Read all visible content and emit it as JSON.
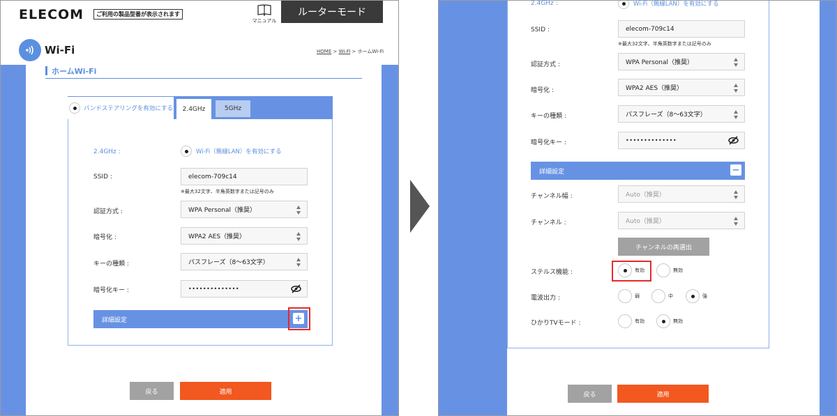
{
  "header": {
    "logo": "ELECOM",
    "tagline": "ご利用の製品型番が表示されます",
    "manual_label": "マニュアル",
    "mode_label": "ルーターモード"
  },
  "page": {
    "title": "Wi-Fi",
    "breadcrumb_home": "HOME",
    "breadcrumb_sep1": " > ",
    "breadcrumb_wifi": "Wi-Fi",
    "breadcrumb_sep2": " > ",
    "breadcrumb_current": "ホームWi-Fi",
    "section_title": "ホームWi-Fi"
  },
  "tabs": {
    "band_steering_label": "バンドステアリングを有効にする",
    "tab_24": "2.4GHz",
    "tab_5": "5GHz"
  },
  "form": {
    "band_label": "2.4GHz :",
    "enable_wifi_label": "Wi-Fi（無線LAN）を有効にする",
    "ssid_label": "SSID :",
    "ssid_value": "elecom-709c14",
    "ssid_note": "※最大32文字、半角英数字または記号のみ",
    "auth_label": "認証方式 :",
    "auth_value": "WPA Personal（推奨）",
    "encryption_label": "暗号化 :",
    "encryption_value": "WPA2 AES（推奨）",
    "keytype_label": "キーの種類 :",
    "keytype_value": "パスフレーズ（8～63文字）",
    "key_label": "暗号化キー :",
    "key_value": "••••••••••••••",
    "advanced_label": "詳細設定",
    "advanced_expand": "+",
    "advanced_collapse": "−"
  },
  "advanced": {
    "channel_width_label": "チャンネル幅 :",
    "channel_width_value": "Auto（推奨）",
    "channel_label": "チャンネル :",
    "channel_value": "Auto（推奨）",
    "reselect_button": "チャンネルの再選出",
    "stealth_label": "ステルス機能 :",
    "stealth_on": "有効",
    "stealth_off": "無効",
    "power_label": "電波出力 :",
    "power_low": "弱",
    "power_mid": "中",
    "power_high": "強",
    "hikari_label": "ひかりTVモード :",
    "hikari_on": "有効",
    "hikari_off": "無効"
  },
  "buttons": {
    "back": "戻る",
    "apply": "適用"
  },
  "colors": {
    "accent": "#6792e4",
    "apply": "#f2581f",
    "highlight": "#e52a2a"
  }
}
